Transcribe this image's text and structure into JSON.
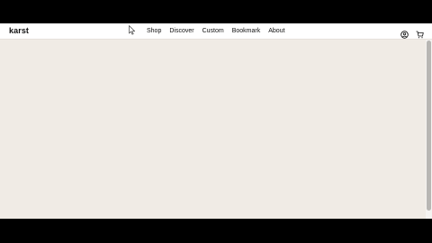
{
  "brand": {
    "logo_text": "karst"
  },
  "nav": {
    "items": [
      {
        "label": "Shop"
      },
      {
        "label": "Discover"
      },
      {
        "label": "Custom"
      },
      {
        "label": "Bookmark"
      },
      {
        "label": "About"
      }
    ]
  },
  "icons": {
    "account": "user-icon",
    "cart": "cart-icon"
  },
  "colors": {
    "page_background": "#f0ebe5",
    "navbar_background": "#ffffff",
    "text": "#111111",
    "letterbox": "#000000"
  }
}
